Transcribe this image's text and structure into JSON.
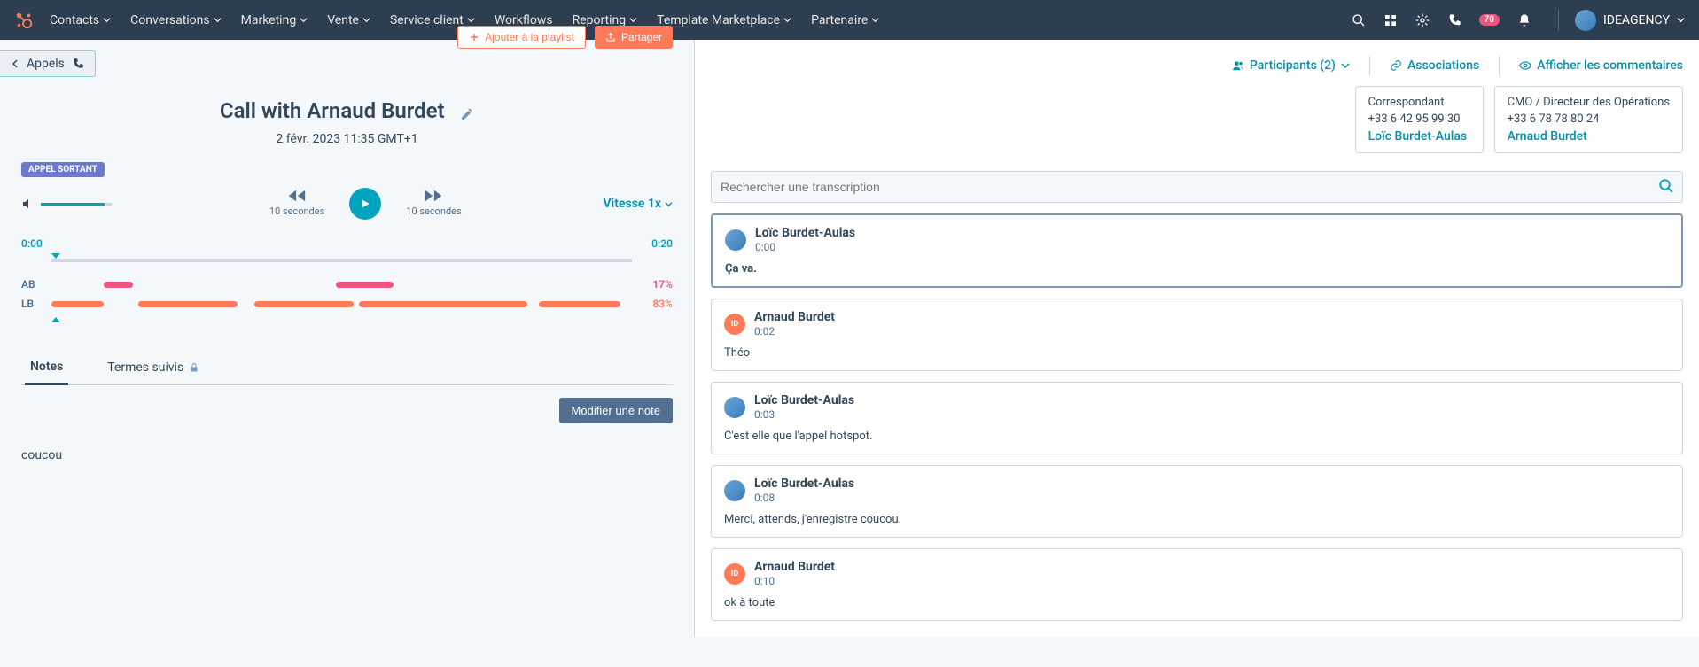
{
  "nav": {
    "items": [
      "Contacts",
      "Conversations",
      "Marketing",
      "Vente",
      "Service client",
      "Workflows",
      "Reporting",
      "Template Marketplace",
      "Partenaire"
    ],
    "badge": "70",
    "account": "IDEAGENCY"
  },
  "back": {
    "label": "Appels"
  },
  "actions": {
    "playlist": "Ajouter à la playlist",
    "share": "Partager"
  },
  "call": {
    "title": "Call with Arnaud Burdet",
    "date": "2 févr. 2023 11:35 GMT+1",
    "tag": "APPEL SORTANT"
  },
  "player": {
    "back_label": "10 secondes",
    "fwd_label": "10 secondes",
    "speed": "Vitesse 1x",
    "start": "0:00",
    "end": "0:20"
  },
  "speakers": {
    "ab": {
      "label": "AB",
      "pct": "17%",
      "segments": [
        [
          9,
          5
        ],
        [
          49,
          10
        ]
      ]
    },
    "lb": {
      "label": "LB",
      "pct": "83%",
      "segments": [
        [
          0,
          9
        ],
        [
          15,
          17
        ],
        [
          35,
          17
        ],
        [
          53,
          29
        ],
        [
          84,
          14
        ]
      ]
    }
  },
  "tabs": {
    "notes": "Notes",
    "terms": "Termes suivis",
    "edit_note": "Modifier une note",
    "note_text": "coucou"
  },
  "right": {
    "participants": "Participants (2)",
    "associations": "Associations",
    "comments": "Afficher les commentaires",
    "search_placeholder": "Rechercher une transcription"
  },
  "participants": [
    {
      "role": "Correspondant",
      "phone": "+33 6 42 95 99 30",
      "name": "Loïc Burdet-Aulas"
    },
    {
      "role": "CMO / Directeur des Opérations",
      "phone": "+33 6 78 78 80 24",
      "name": "Arnaud Burdet"
    }
  ],
  "transcript": [
    {
      "speaker": "Loïc Burdet-Aulas",
      "time": "0:00",
      "text": "Ça va.",
      "avatar": "l",
      "active": true,
      "bold": true
    },
    {
      "speaker": "Arnaud Burdet",
      "time": "0:02",
      "text": "Théo",
      "avatar": "a"
    },
    {
      "speaker": "Loïc Burdet-Aulas",
      "time": "0:03",
      "text": "C'est elle que l'appel hotspot.",
      "avatar": "l"
    },
    {
      "speaker": "Loïc Burdet-Aulas",
      "time": "0:08",
      "text": "Merci, attends, j'enregistre coucou.",
      "avatar": "l"
    },
    {
      "speaker": "Arnaud Burdet",
      "time": "0:10",
      "text": "ok à toute",
      "avatar": "a"
    }
  ]
}
